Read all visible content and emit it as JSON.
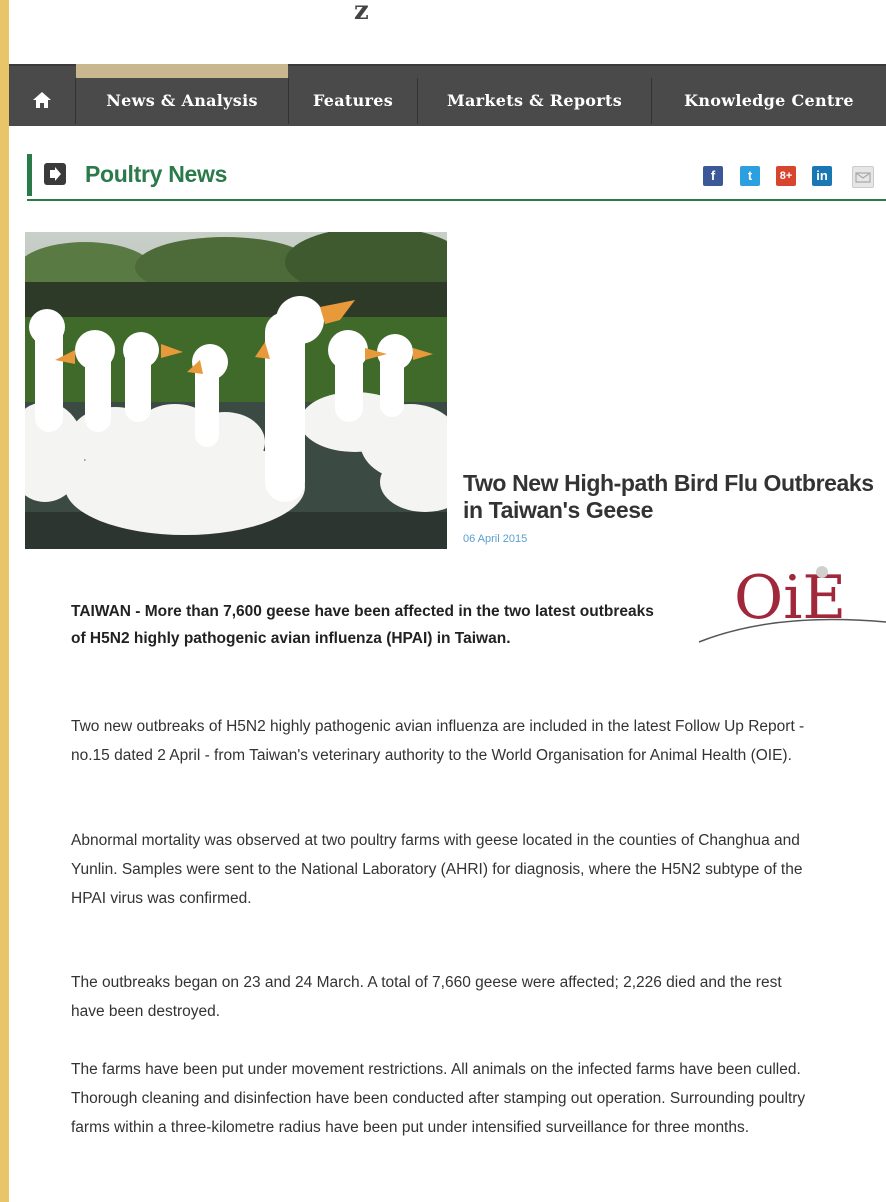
{
  "site": {
    "logo_fragment": "z"
  },
  "nav": {
    "items": [
      "News & Analysis",
      "Features",
      "Markets & Reports",
      "Knowledge Centre"
    ]
  },
  "section": {
    "title": "Poultry News"
  },
  "share": {
    "icons": [
      "facebook-icon",
      "twitter-icon",
      "google-plus-icon",
      "linkedin-icon",
      "email-icon"
    ]
  },
  "article": {
    "headline": "Two New High-path Bird Flu Outbreaks in Taiwan's Geese",
    "date": "06 April 2015",
    "logo_text": "OIE",
    "lead": "TAIWAN - More than 7,600 geese have been affected in the two latest outbreaks of H5N2 highly pathogenic avian influenza (HPAI) in Taiwan.",
    "paragraphs": [
      "Two new outbreaks of H5N2 highly pathogenic avian influenza are included in the latest Follow Up Report - no.15 dated 2 April - from Taiwan's veterinary authority to the World Organisation for Animal Health (OIE).",
      "Abnormal mortality was observed at two poultry farms with geese located in the counties of Changhua and Yunlin. Samples were sent to the National Laboratory (AHRI) for diagnosis, where the H5N2 subtype of the HPAI virus was confirmed.",
      "The outbreaks began on 23 and 24 March. A total of 7,660 geese were affected; 2,226 died and the rest have been destroyed.",
      "The farms have been put under movement restrictions. All animals on the infected farms have been culled. Thorough cleaning and disinfection have been conducted after stamping out operation. Surrounding poultry farms within a three-kilometre radius have been put under intensified surveillance for three months."
    ]
  },
  "colors": {
    "page_border": "#e9c56a",
    "nav_bg": "#4a4a4a",
    "nav_accent": "#c8b78f",
    "section_green": "#2a7a4a",
    "date_blue": "#5aa0d0",
    "oie_red": "#a0283a"
  }
}
